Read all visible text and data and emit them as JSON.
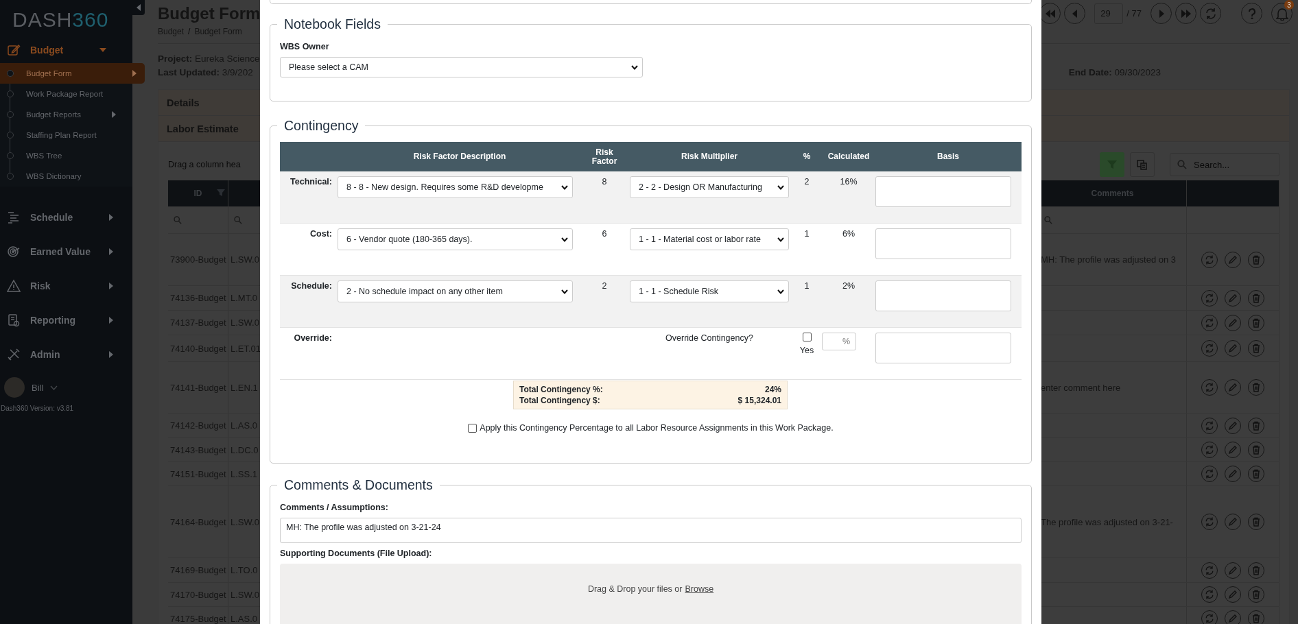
{
  "sidebar": {
    "logo_text": "DASH",
    "logo_accent": "360",
    "items": [
      {
        "label": "Budget",
        "expanded": true,
        "children": [
          {
            "label": "Budget Form",
            "selected": true,
            "has_submenu": true
          },
          {
            "label": "Work Package Report",
            "selected": false,
            "has_submenu": false
          },
          {
            "label": "Budget Reports",
            "selected": false,
            "has_submenu": true
          },
          {
            "label": "Staffing Plan Report",
            "selected": false,
            "has_submenu": false
          },
          {
            "label": "WBS Tree",
            "selected": false,
            "has_submenu": false
          },
          {
            "label": "WBS Dictionary",
            "selected": false,
            "has_submenu": false
          }
        ]
      },
      {
        "label": "Schedule",
        "expanded": false
      },
      {
        "label": "Earned Value",
        "expanded": false
      },
      {
        "label": "Risk",
        "expanded": false
      },
      {
        "label": "Reporting",
        "expanded": false
      },
      {
        "label": "Admin",
        "expanded": false
      }
    ],
    "user": {
      "name": "Bill"
    },
    "version": "Dash360 Version: v3.81"
  },
  "page": {
    "title": "Budget Form",
    "breadcrumb": [
      "Budget",
      "Budget Form"
    ],
    "breadcrumb_separator": "/",
    "project_label": "Project:",
    "project_value": "Eureka Science",
    "updated_label": "Last Updated:",
    "updated_value": "3/9/202",
    "end_date_label": "End Date:",
    "end_date_value": "09/30/2023",
    "sections": [
      "Details",
      "Labor Estimate"
    ],
    "group_hint": "Drag a column hea",
    "search_placeholder": "Search...",
    "pager": {
      "page": "29",
      "total": "/ 77"
    },
    "notifications": "3"
  },
  "table": {
    "columns": [
      "ID",
      "",
      "Comments"
    ],
    "rows": [
      {
        "id": "73900-Budget",
        "column_2": "L.SW.0",
        "comments": "MH: The profile was adjusted on 3"
      },
      {
        "id": "74136-Budget",
        "column_2": "L.MT.0",
        "comments": ""
      },
      {
        "id": "74137-Budget",
        "column_2": "L.SW.0",
        "comments": ""
      },
      {
        "id": "74140-Budget",
        "column_2": "L.ET.01",
        "comments": ""
      },
      {
        "id": "74141-Budget",
        "column_2": "L.EN.1",
        "comments": "enter comment here"
      },
      {
        "id": "74142-Budget",
        "column_2": "L.AS.0",
        "comments": ""
      },
      {
        "id": "74143-Budget",
        "column_2": "L.DC.0",
        "comments": ""
      },
      {
        "id": "74151-Budget",
        "column_2": "L.SS.1",
        "comments": ""
      },
      {
        "id": "74164-Budget",
        "column_2": "L.SW.0",
        "comments": "The profile was adjusted on 3-21-"
      },
      {
        "id": "74169-Budget",
        "column_2": "L.TO.0",
        "comments": ""
      },
      {
        "id": "74170-Budget",
        "column_2": "L.SW.0",
        "comments": ""
      },
      {
        "id": "74175-Budget",
        "column_2": "L.AS.0",
        "comments": ""
      }
    ]
  },
  "modal": {
    "notebook": {
      "legend": "Notebook Fields",
      "wbs_label": "WBS Owner",
      "wbs_value": "Please select a CAM"
    },
    "contingency": {
      "legend": "Contingency",
      "columns": [
        "Risk Factor Description",
        "Risk Factor",
        "Risk Multiplier",
        "%",
        "Calculated",
        "Basis"
      ],
      "rows": [
        {
          "label": "Technical:",
          "description": "8 - 8 - New design. Requires some R&D developme",
          "factor": "8",
          "multiplier": "2 - 2 - Design OR Manufacturing",
          "percent": "2",
          "calculated": "16%"
        },
        {
          "label": "Cost:",
          "description": "6 - Vendor quote (180-365 days).",
          "factor": "6",
          "multiplier": "1 - 1 - Material cost or labor rate",
          "percent": "1",
          "calculated": "6%"
        },
        {
          "label": "Schedule:",
          "description": "2 - No schedule impact on any other item",
          "factor": "2",
          "multiplier": "1 - 1 - Schedule Risk",
          "percent": "1",
          "calculated": "2%"
        }
      ],
      "override": {
        "label": "Override:",
        "question": "Override Contingency?",
        "checked": false,
        "yes_label": "Yes",
        "percent_placeholder": "%"
      },
      "totals": [
        {
          "label": "Total Contingency %:",
          "value": "24%"
        },
        {
          "label": "Total Contingency $:",
          "value": "$ 15,324.01"
        }
      ],
      "apply": {
        "label": "Apply this Contingency Percentage to all Labor Resource Assignments in this Work Package.",
        "checked": false
      }
    },
    "comments": {
      "legend": "Comments & Documents",
      "comments_label": "Comments / Assumptions:",
      "comments_value": "MH: The profile was adjusted on 3-21-24",
      "documents_label": "Supporting Documents (File Upload):",
      "drop_text": "Drag & Drop your files or",
      "browse_link": "Browse"
    }
  }
}
